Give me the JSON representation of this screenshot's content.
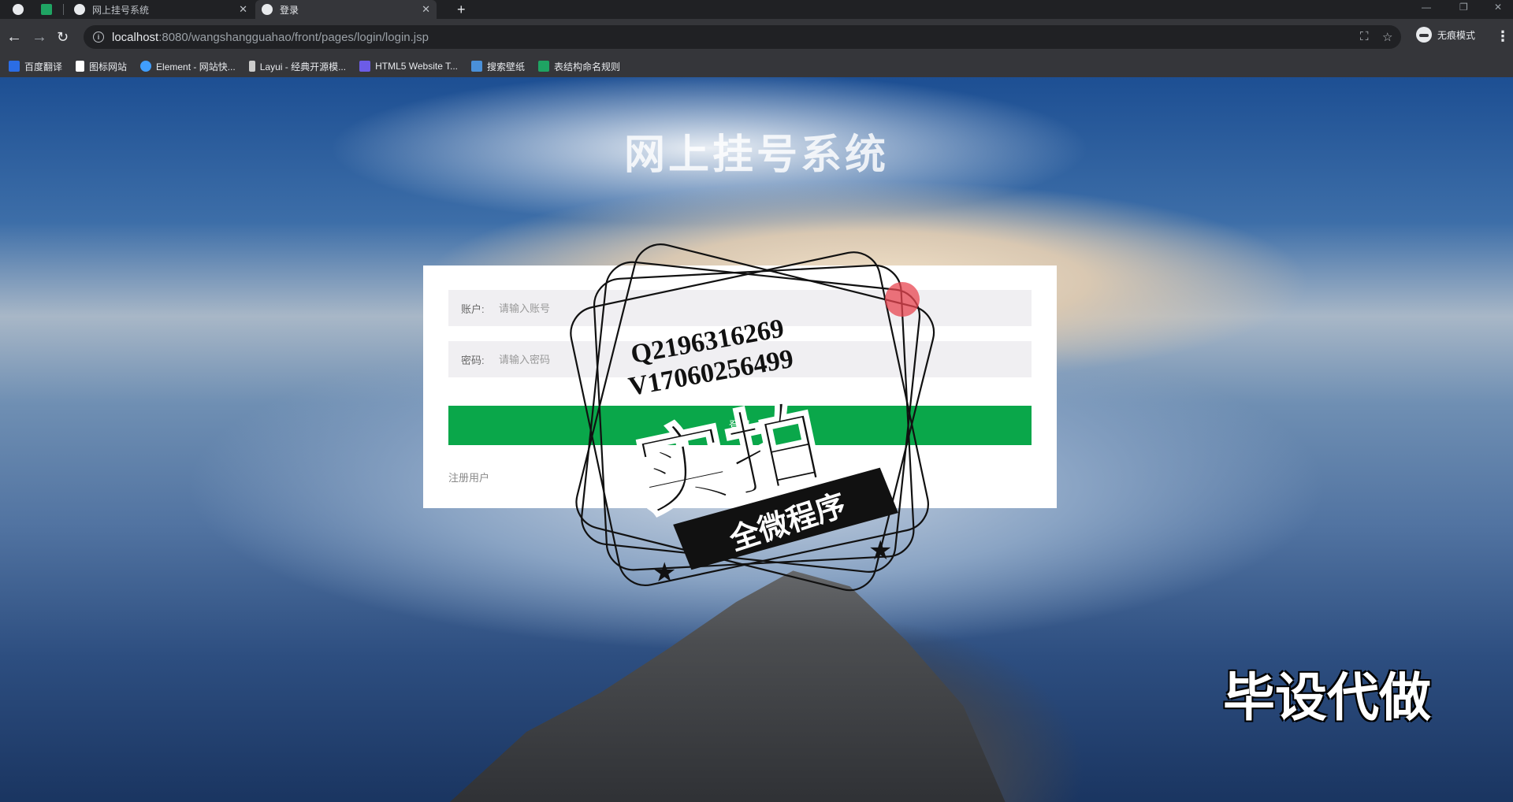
{
  "browser": {
    "tabs": [
      {
        "title": "网上挂号系统",
        "icon": "globe-icon",
        "active": false
      },
      {
        "title": "登录",
        "icon": "globe-icon",
        "active": true
      }
    ],
    "new_tab_glyph": "+",
    "url_host": "localhost",
    "url_rest": ":8080/wangshangguahao/front/pages/login/login.jsp",
    "profile_label": "无痕模式",
    "bookmarks": [
      {
        "label": "百度翻译",
        "icon": "translate-icon",
        "color": "#2b6de5"
      },
      {
        "label": "图标网站",
        "icon": "flag-icon",
        "color": "#ffffff"
      },
      {
        "label": "Element - 网站快...",
        "icon": "element-icon",
        "color": "#409eff"
      },
      {
        "label": "Layui - 经典开源模...",
        "icon": "layui-icon",
        "color": "#cccccc"
      },
      {
        "label": "HTML5 Website T...",
        "icon": "html5-icon",
        "color": "#6c5ce7"
      },
      {
        "label": "搜索壁纸",
        "icon": "wallpaper-icon",
        "color": "#4a90d9"
      },
      {
        "label": "表结构命名规则",
        "icon": "sheet-icon",
        "color": "#1fa463"
      }
    ]
  },
  "page": {
    "title": "网上挂号系统",
    "account_label": "账户:",
    "account_placeholder": "请输入账号",
    "password_label": "密码:",
    "password_placeholder": "请输入密码",
    "login_button": "登录",
    "register_link": "注册用户"
  },
  "overlays": {
    "stamp_line1": "Q2196316269",
    "stamp_line2": "V17060256499",
    "stamp_big": "实拍",
    "stamp_banner": "全微程序",
    "corner_watermark": "毕设代做"
  },
  "colors": {
    "login_button": "#0aa74a",
    "field_background": "#f0eff2"
  }
}
